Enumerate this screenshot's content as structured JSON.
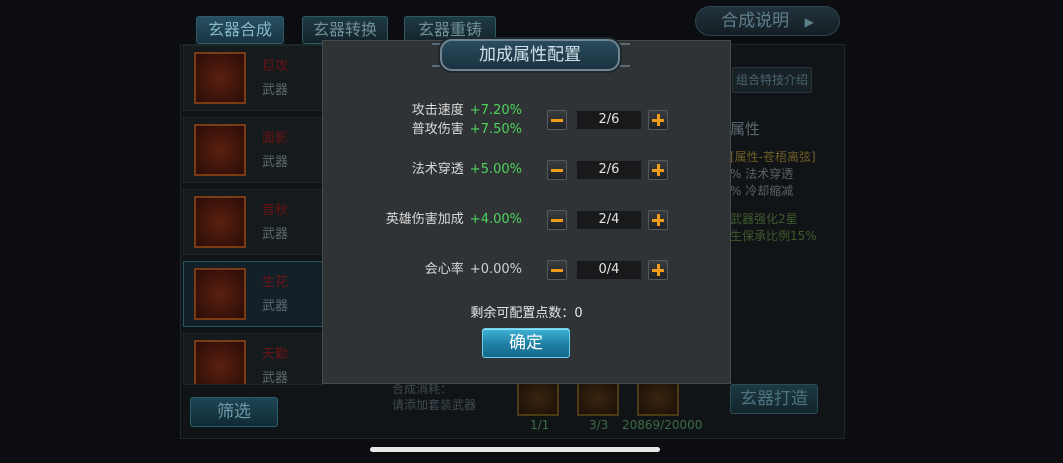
{
  "tabs": [
    {
      "label": "玄器合成"
    },
    {
      "label": "玄器转换"
    },
    {
      "label": "玄器重铸"
    }
  ],
  "help_button": "合成说明",
  "weapons": [
    {
      "name": "巨攻",
      "type": "武器"
    },
    {
      "name": "面影",
      "type": "武器"
    },
    {
      "name": "音秋",
      "type": "武器"
    },
    {
      "name": "生花",
      "type": "武器"
    },
    {
      "name": "天勤",
      "type": "武器"
    }
  ],
  "filter_button": "筛选",
  "right_panel": {
    "combo_button": "组合特技介绍",
    "attr_title": "属性",
    "set_name": "[属性-苍梧离弦]",
    "line1": "% 法术穿透",
    "line2": "% 冷却缩减",
    "line3": "武器强化2星",
    "line4": "生保承比例15%"
  },
  "cost": {
    "label1": "合成消耗：",
    "label2": "请添加套装武器",
    "counts": [
      "1/1",
      "3/3",
      "20869/20000"
    ]
  },
  "forge_button": "玄器打造",
  "modal": {
    "title": "加成属性配置",
    "rows": [
      {
        "lines": [
          {
            "label": "攻击速度",
            "bonus": "+7.20%"
          },
          {
            "label": "普攻伤害",
            "bonus": "+7.50%"
          }
        ],
        "value": "2/6"
      },
      {
        "lines": [
          {
            "label": "法术穿透",
            "bonus": "+5.00%"
          }
        ],
        "value": "2/6"
      },
      {
        "lines": [
          {
            "label": "英雄伤害加成",
            "bonus": "+4.00%"
          }
        ],
        "value": "2/4"
      },
      {
        "lines": [
          {
            "label": "会心率",
            "bonus": "+0.00%"
          }
        ],
        "value": "0/4"
      }
    ],
    "remaining": "剩余可配置点数：0",
    "confirm": "确定"
  }
}
